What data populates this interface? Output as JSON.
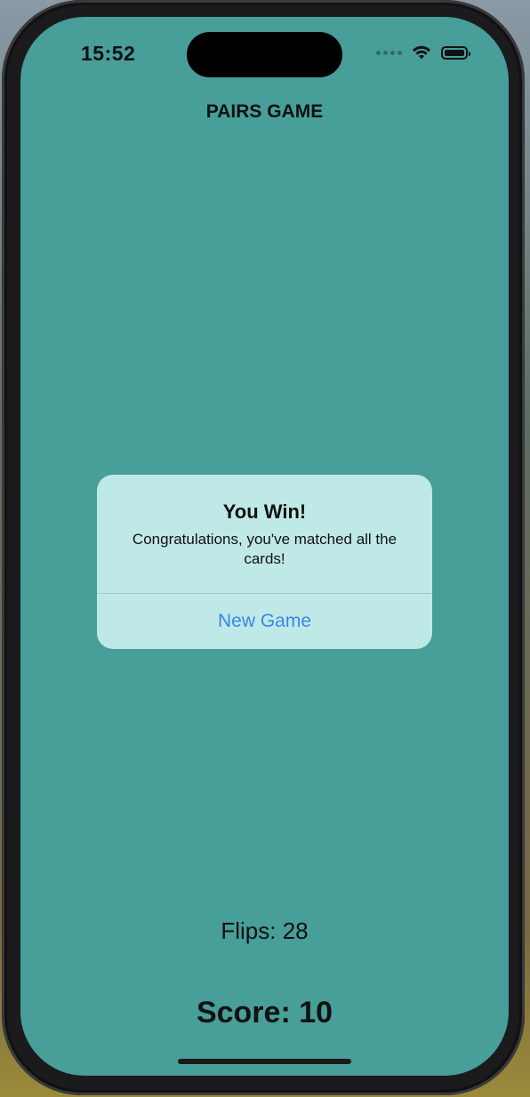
{
  "status_bar": {
    "time": "15:52",
    "icons": [
      "cellular-signal-icon",
      "wifi-icon",
      "battery-icon"
    ]
  },
  "app": {
    "title": "PAIRS GAME",
    "background_color": "#489e98"
  },
  "alert": {
    "title": "You Win!",
    "message": "Congratulations, you've matched all the cards!",
    "button_label": "New Game",
    "background_color": "#bfe9e7",
    "button_color": "#3a86e8"
  },
  "stats": {
    "flips_label": "Flips: 28",
    "score_label": "Score: 10"
  }
}
